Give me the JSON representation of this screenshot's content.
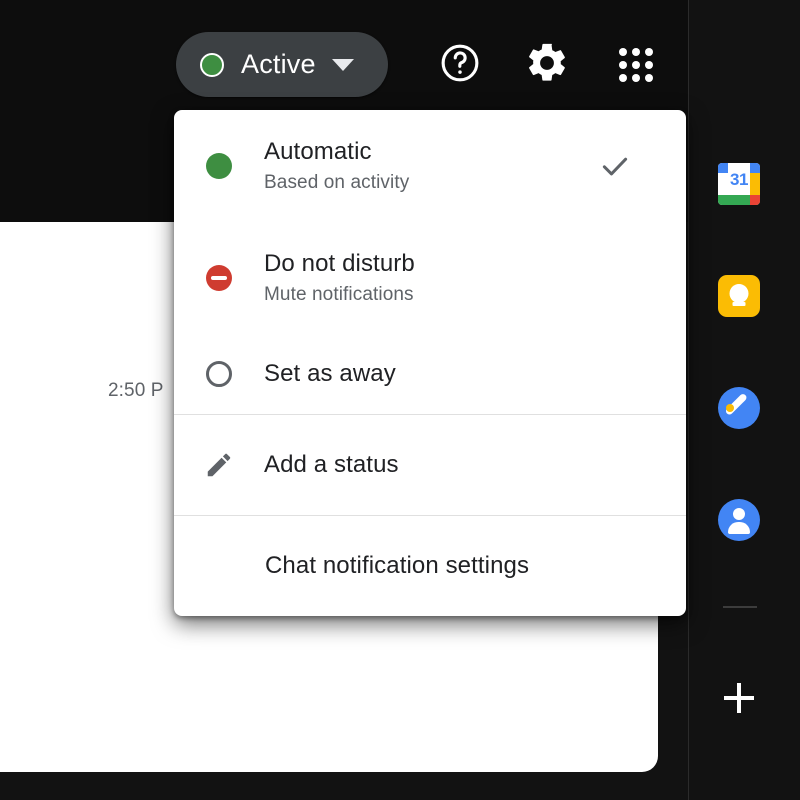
{
  "header": {
    "status_pill": {
      "label": "Active",
      "dot_color": "#3e8e41",
      "background": "#3c4043",
      "caret_icon": "chevron-down-icon"
    },
    "icons": [
      {
        "name": "help-icon",
        "label": "Help"
      },
      {
        "name": "gear-icon",
        "label": "Settings"
      },
      {
        "name": "apps-grid-icon",
        "label": "Google apps"
      }
    ],
    "avatar": {
      "name": "account-avatar",
      "ring_colors": [
        "#1a73e8",
        "#34a853",
        "#fbbc04",
        "#ea4335"
      ]
    }
  },
  "content": {
    "timestamp": "2:50 P"
  },
  "status_menu": {
    "items": [
      {
        "id": "automatic",
        "title": "Automatic",
        "subtitle": "Based on activity",
        "icon": "green-dot-icon",
        "icon_color": "#3e8e41",
        "selected": true,
        "check_icon": "check-icon"
      },
      {
        "id": "do-not-disturb",
        "title": "Do not disturb",
        "subtitle": "Mute notifications",
        "icon": "do-not-disturb-icon",
        "icon_color": "#cf3c30",
        "selected": false
      },
      {
        "id": "set-as-away",
        "title": "Set as away",
        "subtitle": "",
        "icon": "away-circle-icon",
        "icon_color": "#5f6368",
        "selected": false
      }
    ],
    "add_status": {
      "label": "Add a status",
      "icon": "pencil-icon"
    },
    "notification_settings": {
      "label": "Chat notification settings"
    }
  },
  "sidebar": {
    "items": [
      {
        "id": "calendar",
        "name": "google-calendar-icon",
        "label": "Calendar",
        "badge": "31"
      },
      {
        "id": "keep",
        "name": "google-keep-icon",
        "label": "Keep"
      },
      {
        "id": "tasks",
        "name": "google-tasks-icon",
        "label": "Tasks"
      },
      {
        "id": "contacts",
        "name": "google-contacts-icon",
        "label": "Contacts"
      }
    ],
    "add_button": {
      "name": "add-icon",
      "label": "+"
    }
  }
}
